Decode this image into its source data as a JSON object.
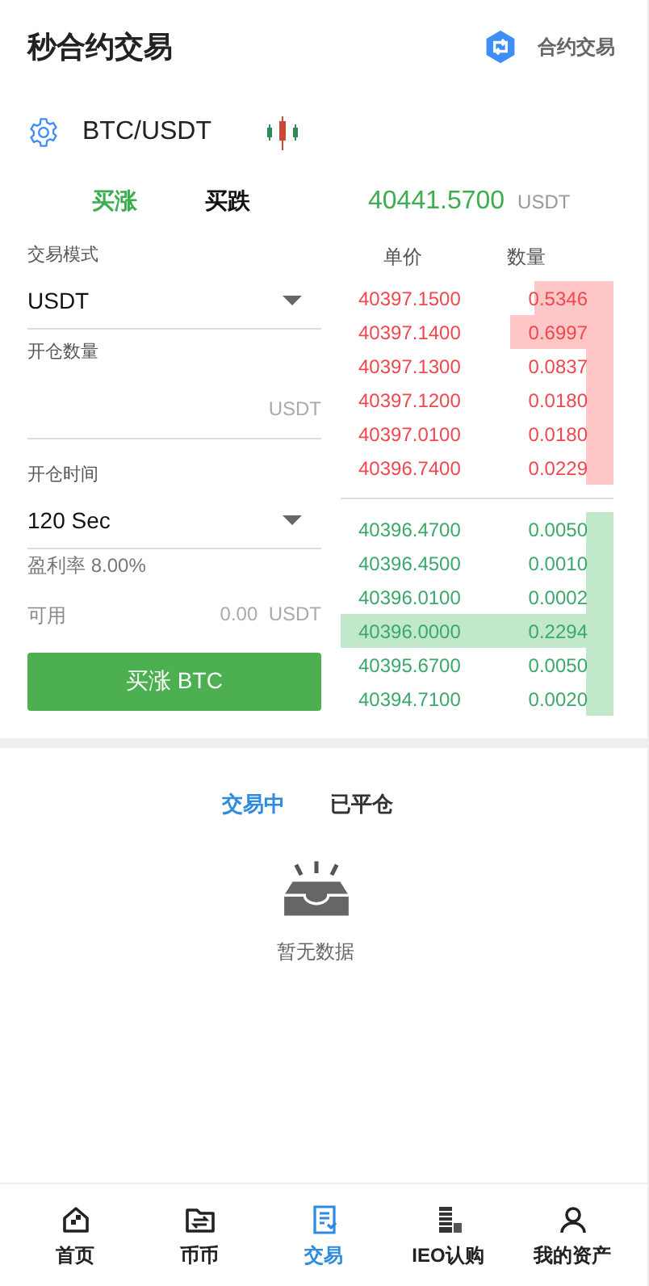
{
  "header": {
    "title": "秒合约交易",
    "link": "合约交易"
  },
  "pair": {
    "symbol": "BTC/USDT"
  },
  "direction_tabs": [
    {
      "label": "买涨",
      "selected": true
    },
    {
      "label": "买跌",
      "selected": false
    }
  ],
  "price": {
    "value": "40441.5700",
    "unit": "USDT"
  },
  "form": {
    "mode_label": "交易模式",
    "mode_value": "USDT",
    "amount_label": "开仓数量",
    "amount_unit": "USDT",
    "time_label": "开仓时间",
    "time_value": "120 Sec",
    "profit_rate": "盈利率 8.00%",
    "available_label": "可用",
    "available_value": "0.00",
    "available_unit": "USDT",
    "submit": "买涨 BTC"
  },
  "order_book": {
    "columns": [
      "单价",
      "数量"
    ],
    "asks": [
      {
        "price": "40397.1500",
        "amount": "0.5346"
      },
      {
        "price": "40397.1400",
        "amount": "0.6997"
      },
      {
        "price": "40397.1300",
        "amount": "0.0837"
      },
      {
        "price": "40397.1200",
        "amount": "0.0180"
      },
      {
        "price": "40397.0100",
        "amount": "0.0180"
      },
      {
        "price": "40396.7400",
        "amount": "0.0229"
      }
    ],
    "bids": [
      {
        "price": "40396.4700",
        "amount": "0.0050",
        "selected": false
      },
      {
        "price": "40396.4500",
        "amount": "0.0010",
        "selected": false
      },
      {
        "price": "40396.0100",
        "amount": "0.0002",
        "selected": false
      },
      {
        "price": "40396.0000",
        "amount": "0.2294",
        "selected": true
      },
      {
        "price": "40395.6700",
        "amount": "0.0050",
        "selected": false
      },
      {
        "price": "40394.7100",
        "amount": "0.0020",
        "selected": false
      }
    ]
  },
  "order_tabs": [
    {
      "label": "交易中",
      "selected": true
    },
    {
      "label": "已平仓",
      "selected": false
    }
  ],
  "empty_text": "暂无数据",
  "bottom_nav": [
    {
      "label": "首页",
      "selected": false
    },
    {
      "label": "币币",
      "selected": false
    },
    {
      "label": "交易",
      "selected": true
    },
    {
      "label": "IEO认购",
      "selected": false
    },
    {
      "label": "我的资产",
      "selected": false
    }
  ]
}
